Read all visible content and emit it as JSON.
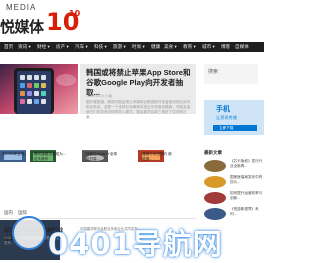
{
  "brand": {
    "media_label": "MEDIA",
    "logo_text": "悦媒体",
    "anniversary": "10th",
    "accent_color": "#d81e06"
  },
  "nav": {
    "items": [
      {
        "label": "首页"
      },
      {
        "label": "资讯 ▾"
      },
      {
        "label": "财经 ▾"
      },
      {
        "label": "房产 ▾"
      },
      {
        "label": "汽车 ▾"
      },
      {
        "label": "科技 ▾"
      },
      {
        "label": "旅游 ▾"
      },
      {
        "label": "时尚 ▾"
      },
      {
        "label": "健康"
      },
      {
        "label": "美食 ▾"
      },
      {
        "label": "教育 ▾"
      },
      {
        "label": "城市 ▾"
      },
      {
        "label": "博客"
      },
      {
        "label": "自媒体"
      }
    ]
  },
  "hero": {
    "title": "韩国或将禁止苹果App Store和谷歌Google Play向开发者抽取...",
    "meta": "2021-08-16  小编",
    "body": "据外媒报道，韩国可能会禁止苹果和谷歌强制开发者使用其应用内购买系统，这是一个全球针对两家科技巨头的首创措施，可能会迫使它们改变其全球的收入模式。国会委员会周三推进了这项修正案..."
  },
  "sidebar": {
    "top_label": "搜索",
    "ad": {
      "title": "手机",
      "subtitle": "让资讯传递",
      "button": "立即下载"
    },
    "heading": "最新文章",
    "items": [
      {
        "text": "《芯卡版权》发行行业全新再..."
      },
      {
        "text": "国家医保局发布中药饮片..."
      },
      {
        "text": "如何提升运营效率与创新..."
      },
      {
        "text": "《悦游新视界》系列..."
      }
    ]
  },
  "thumbs": [
    {
      "caption": "到2030年全球..."
    },
    {
      "caption": "腾讯旗舰手游成为...巨头新作"
    },
    {
      "caption": "特斯拉Model Y全球交付量..."
    },
    {
      "caption": "潍柴与丰田签约 新能源..."
    }
  ],
  "tabs": [
    {
      "label": "国内"
    },
    {
      "label": "国际"
    }
  ],
  "bottom_article": {
    "title": "如认定体系引领建材行业全面升...",
    "meta": "2021-08-16  这是由中国建材联合会主导发布...",
    "sub": "中国建材联合会联合多家企业共同发布..."
  },
  "watermark": {
    "text": "0401导航网"
  }
}
